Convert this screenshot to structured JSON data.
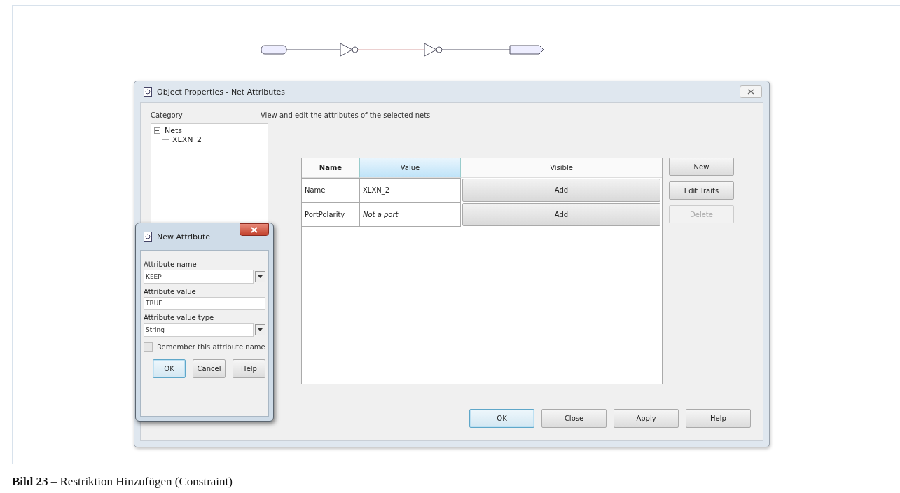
{
  "main_dialog": {
    "title": "Object Properties - Net Attributes",
    "category_label": "Category",
    "tree": [
      {
        "label": "Nets",
        "expanded": true,
        "children": [
          {
            "label": "XLXN_2"
          }
        ]
      }
    ],
    "description": "View and edit the attributes of the selected nets",
    "table": {
      "columns": [
        {
          "label": "Name",
          "selected": false
        },
        {
          "label": "Value",
          "selected": true
        },
        {
          "label": "Visible",
          "selected": false
        }
      ],
      "rows": [
        {
          "name": "Name",
          "value": "XLXN_2",
          "italic": false,
          "visible": "Add"
        },
        {
          "name": "PortPolarity",
          "value": "Not a port",
          "italic": true,
          "visible": "Add"
        }
      ]
    },
    "side_buttons": [
      {
        "label": "New",
        "disabled": false
      },
      {
        "label": "Edit Traits",
        "disabled": false
      },
      {
        "label": "Delete",
        "disabled": true
      }
    ],
    "buttons": [
      {
        "label": "OK",
        "default": true
      },
      {
        "label": "Close",
        "default": false
      },
      {
        "label": "Apply",
        "default": false
      },
      {
        "label": "Help",
        "default": false
      }
    ]
  },
  "new_attribute_dialog": {
    "title": "New Attribute",
    "fields": [
      {
        "label": "Attribute name",
        "value": "KEEP",
        "kind": "dropdown"
      },
      {
        "label": "Attribute value",
        "value": "TRUE",
        "kind": "text"
      },
      {
        "label": "Attribute value type",
        "value": "String",
        "kind": "dropdown"
      }
    ],
    "checkbox": {
      "label": "Remember this attribute name",
      "checked": false
    },
    "buttons": [
      {
        "label": "OK",
        "default": true
      },
      {
        "label": "Cancel",
        "default": false
      },
      {
        "label": "Help",
        "default": false
      }
    ]
  },
  "caption": "**Bild 23** – Restriktion Hinzufügen (Constraint)"
}
